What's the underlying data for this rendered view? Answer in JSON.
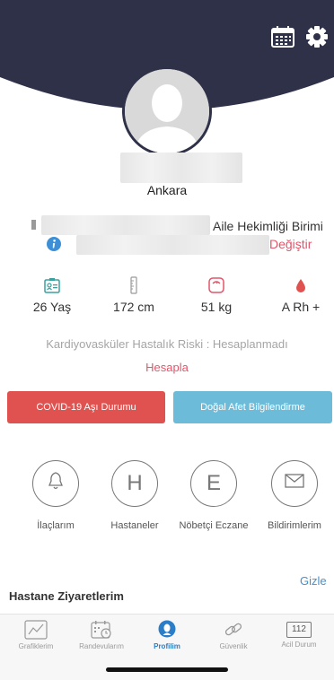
{
  "colors": {
    "header": "#2f3149",
    "accent": "#e0566a",
    "link": "#4a90c8",
    "active_tab": "#2c7dc8",
    "covid_button": "#e0524f",
    "disaster_button": "#6bbbd9"
  },
  "header": {
    "icons": [
      "calendar-icon",
      "gear-icon"
    ]
  },
  "profile": {
    "city": "Ankara"
  },
  "family_doctor": {
    "unit_label": "Aile Hekimliği Birimi",
    "change_link": "Değiştir"
  },
  "stats": [
    {
      "icon": "id-card-icon",
      "value": "26 Yaş"
    },
    {
      "icon": "ruler-icon",
      "value": "172 cm"
    },
    {
      "icon": "scale-icon",
      "value": "51 kg"
    },
    {
      "icon": "blood-drop-icon",
      "value": "A Rh +"
    }
  ],
  "risk": {
    "text": "Kardiyovasküler Hastalık Riski : Hesaplanmadı",
    "calculate_link": "Hesapla"
  },
  "buttons": {
    "covid": "COVID-19 Aşı Durumu",
    "disaster": "Doğal Afet Bilgilendirme"
  },
  "quick_actions": [
    {
      "icon": "bell-icon",
      "glyph": "",
      "label": "İlaçlarım"
    },
    {
      "icon": "hospital-icon",
      "glyph": "H",
      "label": "Hastaneler"
    },
    {
      "icon": "pharmacy-icon",
      "glyph": "E",
      "label": "Nöbetçi Eczane"
    },
    {
      "icon": "envelope-icon",
      "glyph": "",
      "label": "Bildirimlerim"
    }
  ],
  "visits": {
    "hide_link": "Gizle",
    "title": "Hastane Ziyaretlerim"
  },
  "tabbar": [
    {
      "icon": "chart-icon",
      "label": "Grafiklerim",
      "active": false
    },
    {
      "icon": "appointment-icon",
      "label": "Randevularım",
      "active": false
    },
    {
      "icon": "profile-icon",
      "label": "Profilim",
      "active": true
    },
    {
      "icon": "link-icon",
      "label": "Güvenlik",
      "active": false
    },
    {
      "icon": "emergency-icon",
      "label": "Acil Durum",
      "badge": "112",
      "active": false
    }
  ]
}
